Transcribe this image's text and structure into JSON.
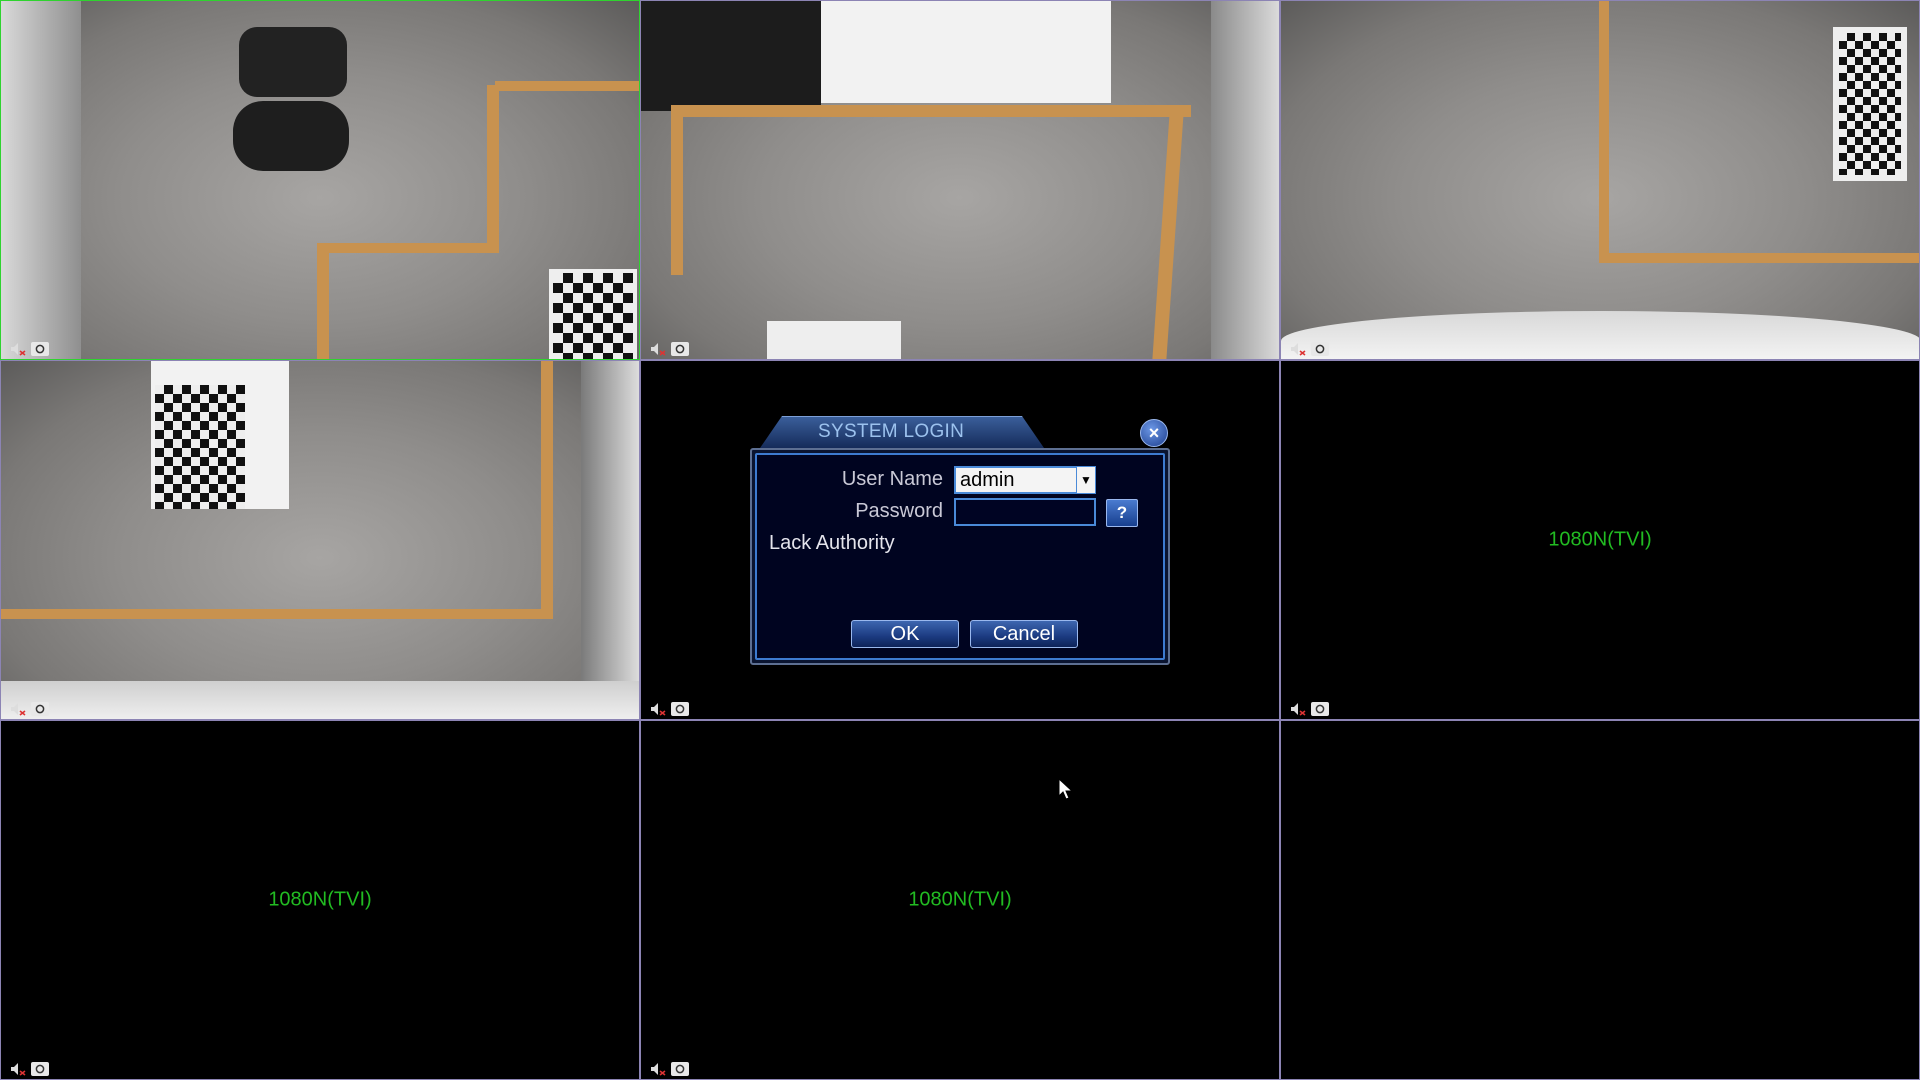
{
  "cameras": [
    {
      "id": 1,
      "status": "live",
      "overlay": ""
    },
    {
      "id": 2,
      "status": "live",
      "overlay": ""
    },
    {
      "id": 3,
      "status": "live",
      "overlay": ""
    },
    {
      "id": 4,
      "status": "live",
      "overlay": ""
    },
    {
      "id": 5,
      "status": "no-signal",
      "overlay": ""
    },
    {
      "id": 6,
      "status": "no-signal",
      "overlay": "1080N(TVI)"
    },
    {
      "id": 7,
      "status": "no-signal",
      "overlay": "1080N(TVI)"
    },
    {
      "id": 8,
      "status": "no-signal",
      "overlay": "1080N(TVI)"
    },
    {
      "id": 9,
      "status": "no-signal",
      "overlay": ""
    }
  ],
  "channel_controls": {
    "audio_icon": "mute-speaker-icon",
    "snapshot_icon": "camera-snapshot-icon"
  },
  "login": {
    "title": "SYSTEM LOGIN",
    "close_icon": "close-icon",
    "username_label": "User Name",
    "username_value": "admin",
    "password_label": "Password",
    "password_value": "",
    "help_label": "?",
    "message": "Lack Authority",
    "ok_label": "OK",
    "cancel_label": "Cancel"
  },
  "colors": {
    "active_border": "#2fd32f",
    "grid_border": "#8c84b4",
    "no_signal_text": "#22bb22",
    "dialog_accent": "#3d7bd0"
  }
}
